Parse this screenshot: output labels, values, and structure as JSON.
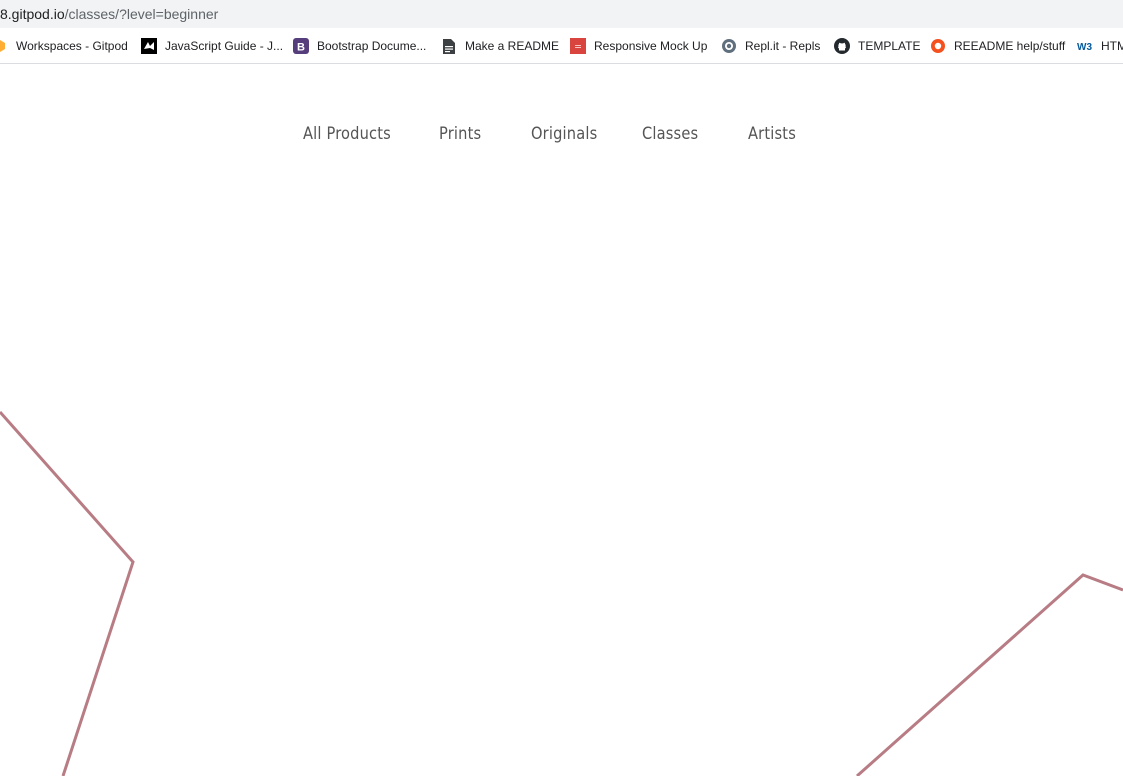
{
  "browser": {
    "url_host": "8.gitpod.io",
    "url_path": "/classes/?level=beginner"
  },
  "bookmarks": [
    {
      "label": "Workspaces - Gitpod",
      "icon": "gitpod-icon"
    },
    {
      "label": "JavaScript Guide - J...",
      "icon": "mdn-icon"
    },
    {
      "label": "Bootstrap Docume...",
      "icon": "bootstrap-icon"
    },
    {
      "label": "Make a README",
      "icon": "document-icon"
    },
    {
      "label": "Responsive Mock Up",
      "icon": "responsive-icon"
    },
    {
      "label": "Repl.it - Repls",
      "icon": "replit-icon"
    },
    {
      "label": "TEMPLATE",
      "icon": "github-icon"
    },
    {
      "label": "REEADME help/stuff",
      "icon": "readme-icon"
    },
    {
      "label": "HTM",
      "icon": "w3schools-icon"
    }
  ],
  "nav": [
    {
      "label": "All Products"
    },
    {
      "label": "Prints"
    },
    {
      "label": "Originals"
    },
    {
      "label": "Classes"
    },
    {
      "label": "Artists"
    }
  ],
  "colors": {
    "decor_line": "#b87c84",
    "nav_text": "#555555",
    "bootstrap_purple": "#563d7c",
    "responsive_red": "#d9443e",
    "readme_orange": "#f4511e",
    "w3_blue": "#04599c"
  }
}
